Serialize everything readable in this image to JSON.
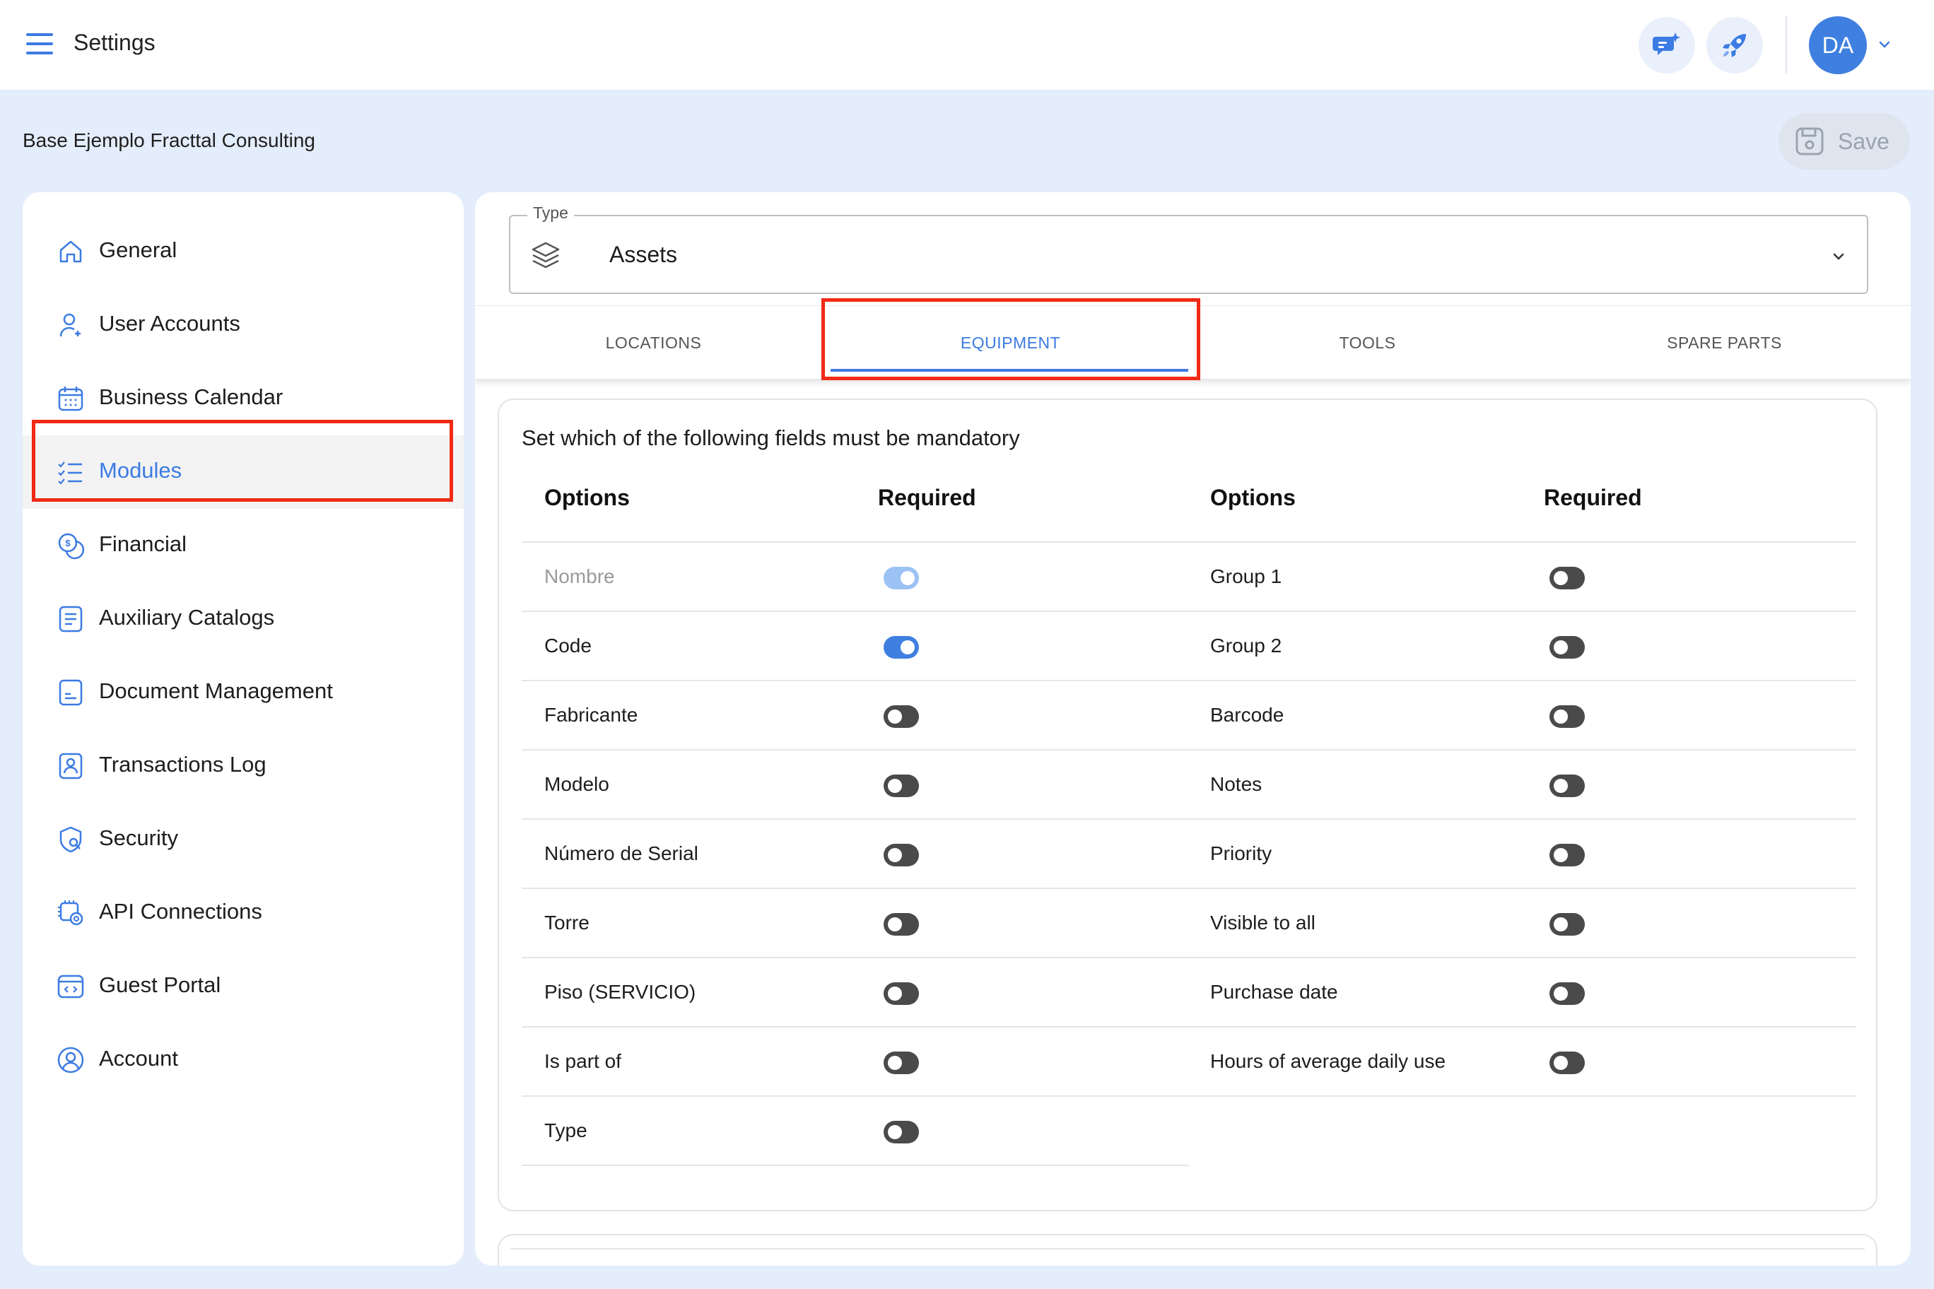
{
  "header": {
    "title": "Settings",
    "avatar_initials": "DA"
  },
  "company": "Base Ejemplo Fracttal Consulting",
  "save_label": "Save",
  "sidebar": {
    "items": [
      {
        "label": "General",
        "icon": "home-icon"
      },
      {
        "label": "User Accounts",
        "icon": "user-add-icon"
      },
      {
        "label": "Business Calendar",
        "icon": "calendar-icon"
      },
      {
        "label": "Modules",
        "icon": "checklist-icon",
        "active": true
      },
      {
        "label": "Financial",
        "icon": "coins-icon"
      },
      {
        "label": "Auxiliary Catalogs",
        "icon": "catalog-icon"
      },
      {
        "label": "Document Management",
        "icon": "document-icon"
      },
      {
        "label": "Transactions Log",
        "icon": "log-icon"
      },
      {
        "label": "Security",
        "icon": "shield-icon"
      },
      {
        "label": "API Connections",
        "icon": "api-gear-icon"
      },
      {
        "label": "Guest Portal",
        "icon": "portal-icon"
      },
      {
        "label": "Account",
        "icon": "account-circle-icon"
      }
    ]
  },
  "type_field": {
    "legend": "Type",
    "value": "Assets"
  },
  "tabs": [
    {
      "label": "LOCATIONS"
    },
    {
      "label": "EQUIPMENT",
      "active": true
    },
    {
      "label": "TOOLS"
    },
    {
      "label": "SPARE PARTS"
    }
  ],
  "fields": {
    "heading": "Set which of the following fields must be mandatory",
    "col_options": "Options",
    "col_required": "Required",
    "left": [
      {
        "label": "Nombre",
        "required": true,
        "disabled": true
      },
      {
        "label": "Code",
        "required": true
      },
      {
        "label": "Fabricante",
        "required": false
      },
      {
        "label": "Modelo",
        "required": false
      },
      {
        "label": "Número de Serial",
        "required": false
      },
      {
        "label": "Torre",
        "required": false
      },
      {
        "label": "Piso (SERVICIO)",
        "required": false
      },
      {
        "label": "Is part of",
        "required": false
      },
      {
        "label": "Type",
        "required": false
      }
    ],
    "right": [
      {
        "label": "Group 1",
        "required": false
      },
      {
        "label": "Group 2",
        "required": false
      },
      {
        "label": "Barcode",
        "required": false
      },
      {
        "label": "Notes",
        "required": false
      },
      {
        "label": "Priority",
        "required": false
      },
      {
        "label": "Visible to all",
        "required": false
      },
      {
        "label": "Purchase date",
        "required": false
      },
      {
        "label": "Hours of average daily use",
        "required": false
      }
    ]
  },
  "colors": {
    "accent": "#3b7be3",
    "highlight": "#f02a14",
    "background": "#e3edfb"
  }
}
